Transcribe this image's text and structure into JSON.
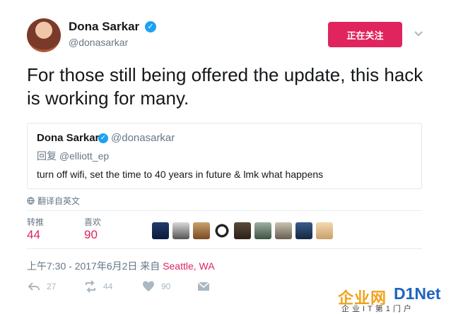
{
  "author": {
    "name": "Dona Sarkar",
    "handle": "@donasarkar",
    "verified": true,
    "follow_label": "正在关注"
  },
  "tweet": {
    "text": "For those still being offered the update, this hack is working for many."
  },
  "quoted_tweet": {
    "name": "Dona Sarkar",
    "handle": "@donasarkar",
    "reply_prefix": "回复",
    "reply_to": "@elliott_ep",
    "text": "turn off wifi, set the time to 40 years in future & lmk what happens"
  },
  "translate_label": "翻译自英文",
  "stats": {
    "retweets_label": "转推",
    "retweets_value": "44",
    "likes_label": "喜欢",
    "likes_value": "90"
  },
  "timestamp": {
    "time": "上午7:30 - 2017年6月2日",
    "from": "来自",
    "location": "Seattle, WA"
  },
  "actions": {
    "reply_count": "27",
    "retweet_count": "44",
    "like_count": "90"
  },
  "watermark": {
    "cn": "企业网",
    "en": "D1Net",
    "sub": "企业IT第1门户"
  },
  "colors": {
    "accent": "#e0245e",
    "verified": "#1da1f2",
    "secondary_text": "#657786",
    "icon": "#aab8c2"
  },
  "liker_avatars": [
    "avatar-1",
    "avatar-2",
    "avatar-3",
    "avatar-4",
    "avatar-5",
    "avatar-6",
    "avatar-7",
    "avatar-8",
    "avatar-9"
  ]
}
